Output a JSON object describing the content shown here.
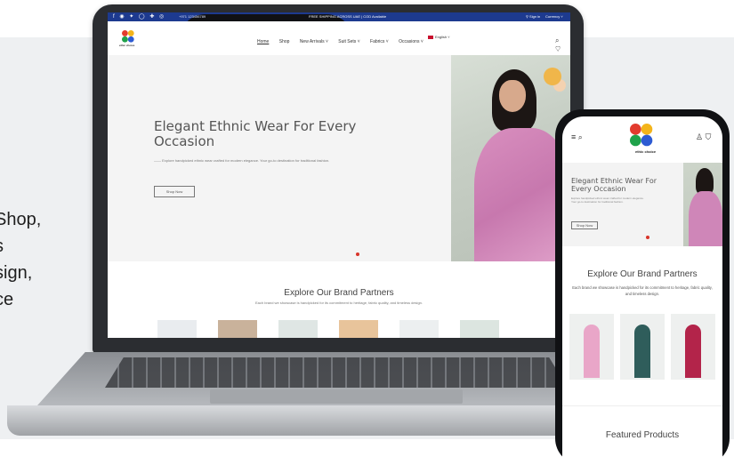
{
  "side_text": [
    "Shop,",
    "s",
    "sign,",
    "ce"
  ],
  "laptop_site": {
    "topbar": {
      "social": "f ◉ ✦ ◯ ✚ ◎",
      "phone": "+971 123456789",
      "promo": "FREE SHIPPING ACROSS UAE | COD Available",
      "signin": "⚲ Sign in",
      "currency": "Currency ˅"
    },
    "brand_name": "ethic choice",
    "nav": [
      "Home",
      "Shop",
      "New Arrivals ˅",
      "Suit Sets ˅",
      "Fabrics ˅",
      "Occasions ˅"
    ],
    "language": "English ˅",
    "header_icons": "⌕ ♡ ⛉",
    "hero": {
      "title": "Elegant Ethnic Wear For Every Occasion",
      "description": "—— Explore handpicked ethnic wear crafted for modern elegance. Your go-to destination for traditional fashion.",
      "button": "Shop Now"
    },
    "brands": {
      "title": "Explore Our Brand Partners",
      "subtitle": "Each brand we showcase is handpicked for its commitment to heritage, fabric quality, and timeless design."
    },
    "brand_card_colors": [
      "#e9ecef",
      "#c9b29b",
      "#dfe6e4",
      "#e8c49b",
      "#eceff0",
      "#dce5e0"
    ]
  },
  "phone_site": {
    "icons_left": "≡ ⌕",
    "icons_right": "♙ ⛉",
    "brand_name": "ethic choice",
    "hero": {
      "title": "Elegant Ethnic Wear For Every Occasion",
      "description": "Explore handpicked ethnic wear crafted for modern elegance. Your go-to destination for traditional fashion.",
      "button": "Shop Now"
    },
    "brands": {
      "title": "Explore Our Brand Partners",
      "subtitle": "Each brand we showcase is handpicked for its commitment to heritage, fabric quality, and timeless design."
    },
    "product_colors": [
      "#e9a6c8",
      "#2f5d5b",
      "#b3244a"
    ],
    "featured_title": "Featured Products"
  }
}
